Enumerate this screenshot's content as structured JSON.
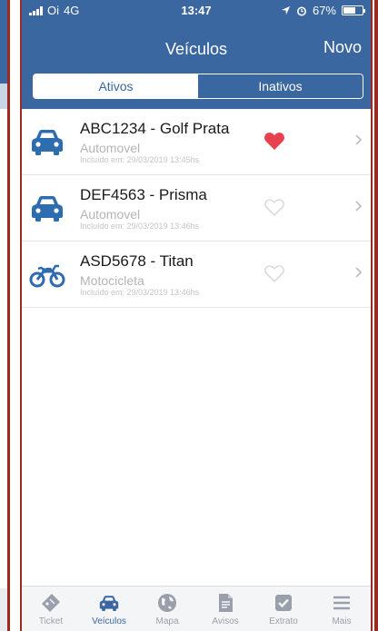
{
  "status_bar": {
    "carrier": "Oi",
    "network": "4G",
    "time": "13:47",
    "battery": "67%"
  },
  "nav": {
    "title": "Veículos",
    "right_button": "Novo"
  },
  "segments": [
    {
      "label": "Ativos",
      "selected": true
    },
    {
      "label": "Inativos",
      "selected": false
    }
  ],
  "vehicles": [
    {
      "title": "ABC1234 - Golf Prata",
      "type": "Automovel",
      "added": "Incluído em: 29/03/2019 13:45hs",
      "icon": "car-icon",
      "favorite": true
    },
    {
      "title": "DEF4563 - Prisma",
      "type": "Automovel",
      "added": "Incluído em: 29/03/2019 13:46hs",
      "icon": "car-icon",
      "favorite": false
    },
    {
      "title": "ASD5678 - Titan",
      "type": "Motocicleta",
      "added": "Incluído em: 29/03/2019 13:46hs",
      "icon": "motorcycle-icon",
      "favorite": false
    }
  ],
  "tabs": [
    {
      "label": "Ticket",
      "icon": "ticket-icon",
      "active": false
    },
    {
      "label": "Veículos",
      "icon": "car-icon",
      "active": true
    },
    {
      "label": "Mapa",
      "icon": "globe-icon",
      "active": false
    },
    {
      "label": "Avisos",
      "icon": "document-icon",
      "active": false
    },
    {
      "label": "Extrato",
      "icon": "checkbox-icon",
      "active": false
    },
    {
      "label": "Mais",
      "icon": "menu-icon",
      "active": false
    }
  ],
  "colors": {
    "primary": "#3a67a0",
    "favorite": "#e5424d",
    "frame": "#9b2a22"
  }
}
